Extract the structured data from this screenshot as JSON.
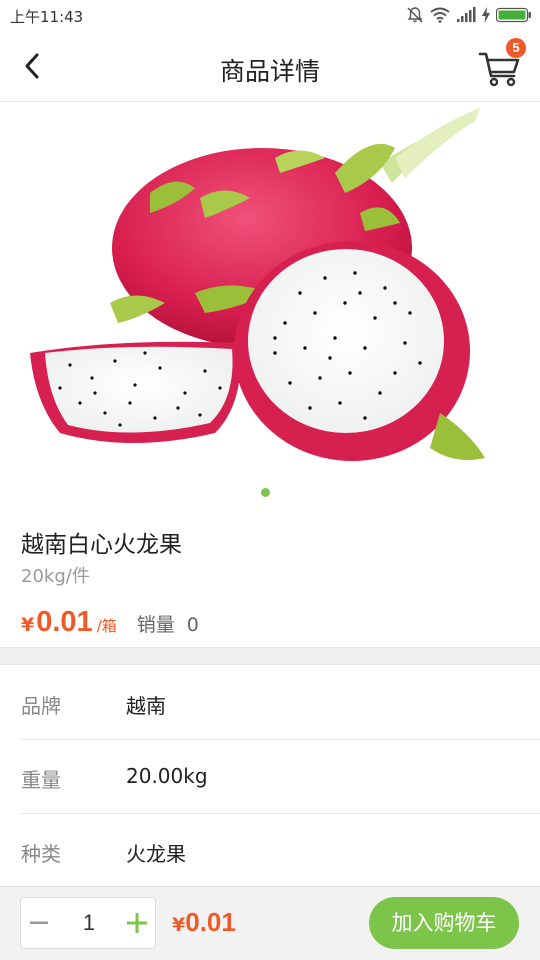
{
  "status_bar": {
    "time": "上午11:43"
  },
  "header": {
    "title": "商品详情",
    "cart_badge": "5"
  },
  "product": {
    "name": "越南白心火龙果",
    "spec": "20kg/件",
    "price_symbol": "¥",
    "price": "0.01",
    "price_unit": "/箱",
    "sales_label": "销量",
    "sales_value": "0"
  },
  "attributes": [
    {
      "label": "品牌",
      "value": "越南"
    },
    {
      "label": "重量",
      "value": "20.00kg"
    },
    {
      "label": "种类",
      "value": "火龙果"
    }
  ],
  "bottom_bar": {
    "quantity": "1",
    "total_symbol": "¥",
    "total": "0.01",
    "add_to_cart_label": "加入购物车"
  },
  "colors": {
    "accent_green": "#7cc54a",
    "price_orange": "#f05a28"
  },
  "icons": [
    "back-arrow-icon",
    "cart-icon",
    "minus-icon",
    "plus-icon",
    "mute-icon",
    "wifi-icon",
    "signal-icon",
    "charging-icon",
    "battery-icon"
  ]
}
